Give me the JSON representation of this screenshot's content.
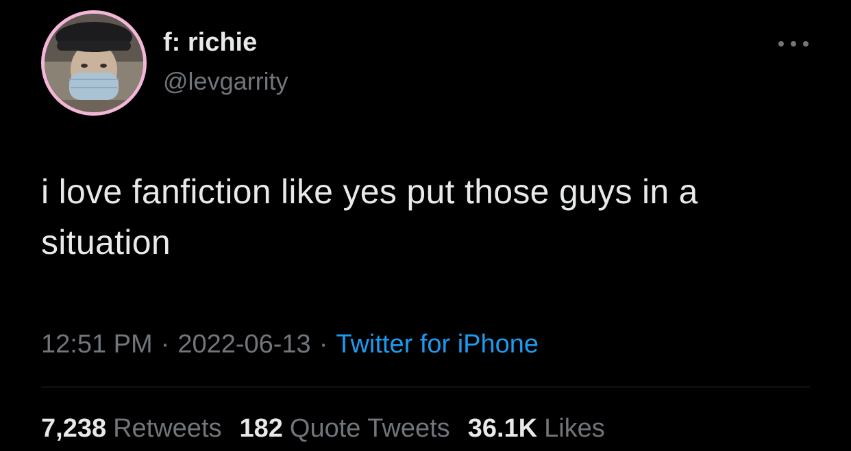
{
  "user": {
    "display_name": "f: richie",
    "handle": "@levgarrity",
    "avatar_icon": "profile-photo-masked-person-beret",
    "avatar_border_color": "#f3b6d8"
  },
  "menu": {
    "icon": "more-horizontal-icon"
  },
  "tweet": {
    "text": "i love fanfiction like yes put those guys in a situation",
    "time": "12:51 PM",
    "date": "2022-06-13",
    "separator": "·",
    "source": "Twitter for iPhone"
  },
  "stats": {
    "retweets_count": "7,238",
    "retweets_label": "Retweets",
    "quotes_count": "182",
    "quotes_label": "Quote Tweets",
    "likes_count": "36.1K",
    "likes_label": "Likes"
  },
  "colors": {
    "background": "#000000",
    "primary_text": "#e7e9ea",
    "secondary_text": "#71767b",
    "link": "#1d9bf0",
    "divider": "#2f3336"
  }
}
